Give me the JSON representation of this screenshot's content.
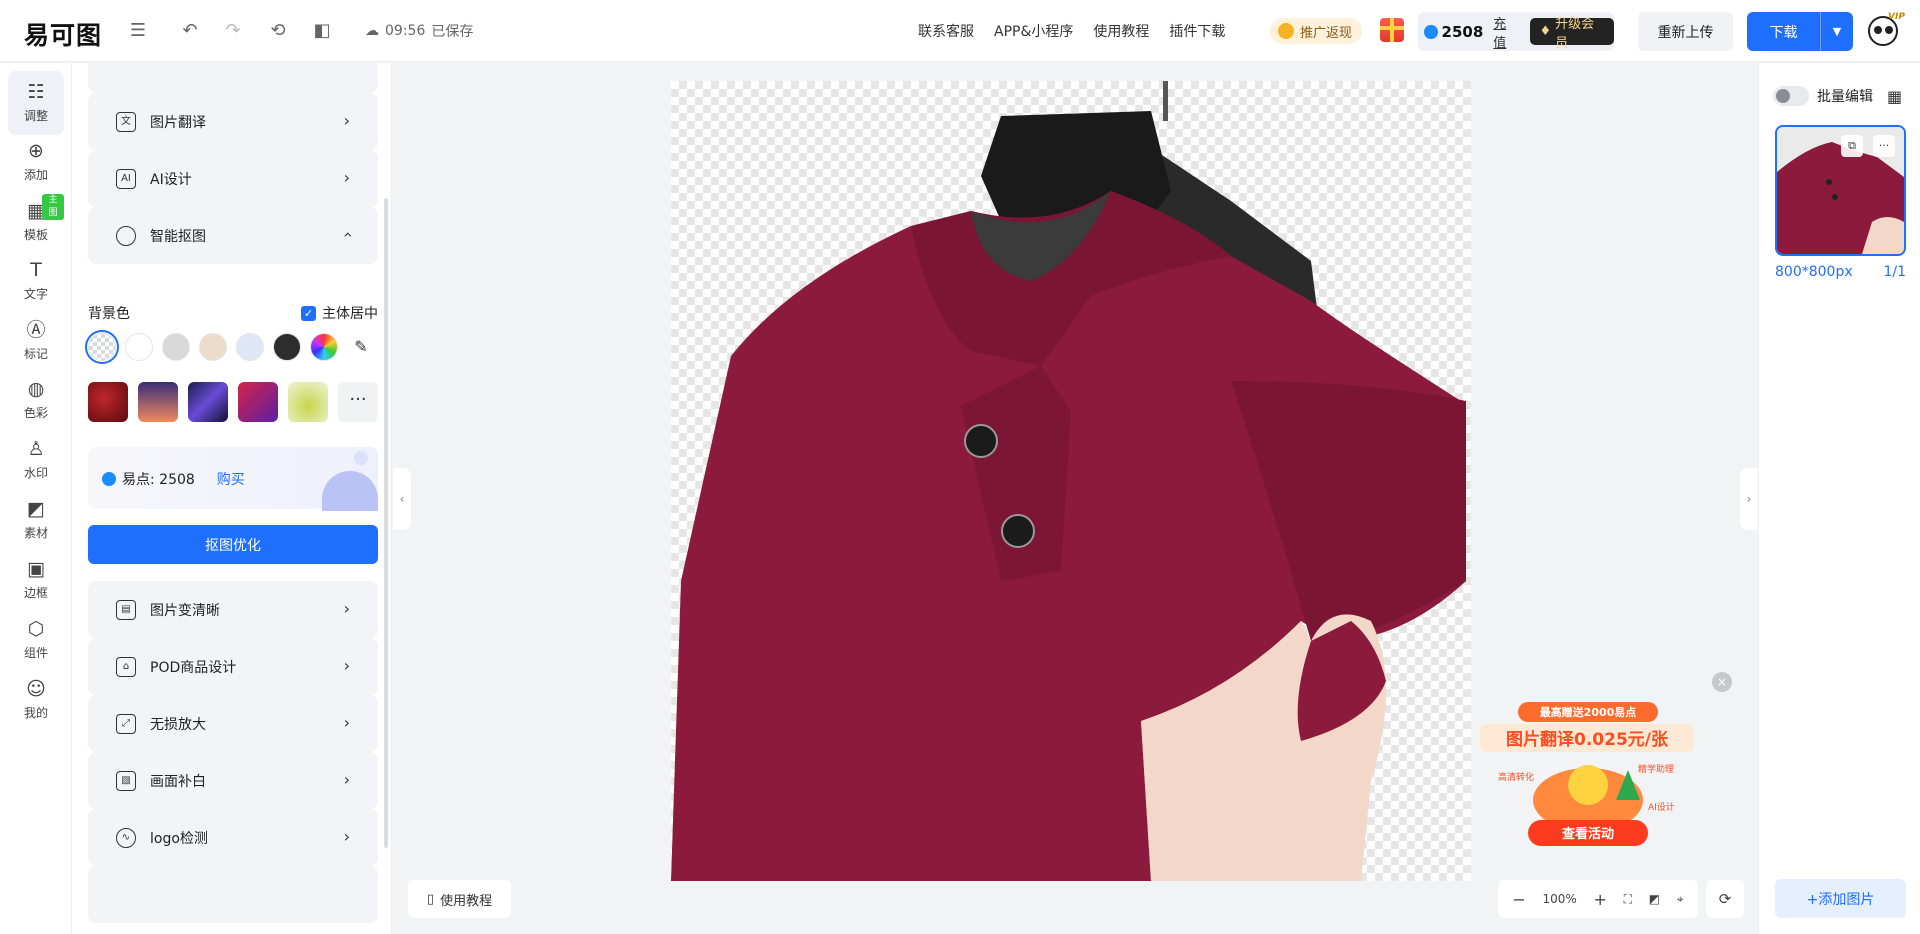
{
  "header": {
    "logo": "易可图",
    "save_time": "09:56",
    "save_status": "已保存",
    "nav": [
      "联系客服",
      "APP&小程序",
      "使用教程",
      "插件下载"
    ],
    "promo": "推广返现",
    "points": "2508",
    "recharge": "充值",
    "upgrade": "升级会员",
    "reupload": "重新上传",
    "download": "下载",
    "vip_tag": "VIP"
  },
  "rail": [
    {
      "label": "调整",
      "icon": "sliders-icon"
    },
    {
      "label": "添加",
      "icon": "plus-circle-icon"
    },
    {
      "label": "模板",
      "icon": "template-icon",
      "badge": "主图"
    },
    {
      "label": "文字",
      "icon": "text-icon"
    },
    {
      "label": "标记",
      "icon": "marker-icon"
    },
    {
      "label": "色彩",
      "icon": "palette-icon"
    },
    {
      "label": "水印",
      "icon": "stamp-icon"
    },
    {
      "label": "素材",
      "icon": "material-icon"
    },
    {
      "label": "边框",
      "icon": "frame-icon"
    },
    {
      "label": "组件",
      "icon": "component-icon"
    },
    {
      "label": "我的",
      "icon": "user-icon"
    }
  ],
  "panel": {
    "cards_top": [
      {
        "label": "图片翻译",
        "icon": "translate-icon"
      },
      {
        "label": "AI设计",
        "icon": "ai-icon"
      },
      {
        "label": "智能抠图",
        "icon": "cutout-icon"
      }
    ],
    "bg_label": "背景色",
    "center_subject": "主体居中",
    "points_text": "易点: 2508",
    "buy": "购买",
    "optimize": "抠图优化",
    "cards_bottom": [
      {
        "label": "图片变清晰",
        "icon": "sharpen-icon"
      },
      {
        "label": "POD商品设计",
        "icon": "pod-icon"
      },
      {
        "label": "无损放大",
        "icon": "enlarge-icon"
      },
      {
        "label": "画面补白",
        "icon": "fill-icon"
      },
      {
        "label": "logo检测",
        "icon": "logo-detect-icon"
      }
    ]
  },
  "canvas": {
    "tutorial": "使用教程",
    "zoom": "100%",
    "ad": {
      "top": "最高赠送2000易点",
      "headline": "图片翻译0.025元/张",
      "tags": [
        "高清转化",
        "精学助理",
        "AI设计"
      ],
      "cta": "查看活动"
    }
  },
  "right": {
    "batch_edit": "批量编辑",
    "size": "800*800px",
    "page": "1/1",
    "add_image": "+添加图片"
  },
  "colors": {
    "accent": "#1f6fff",
    "garment": "#8b1a3c"
  }
}
